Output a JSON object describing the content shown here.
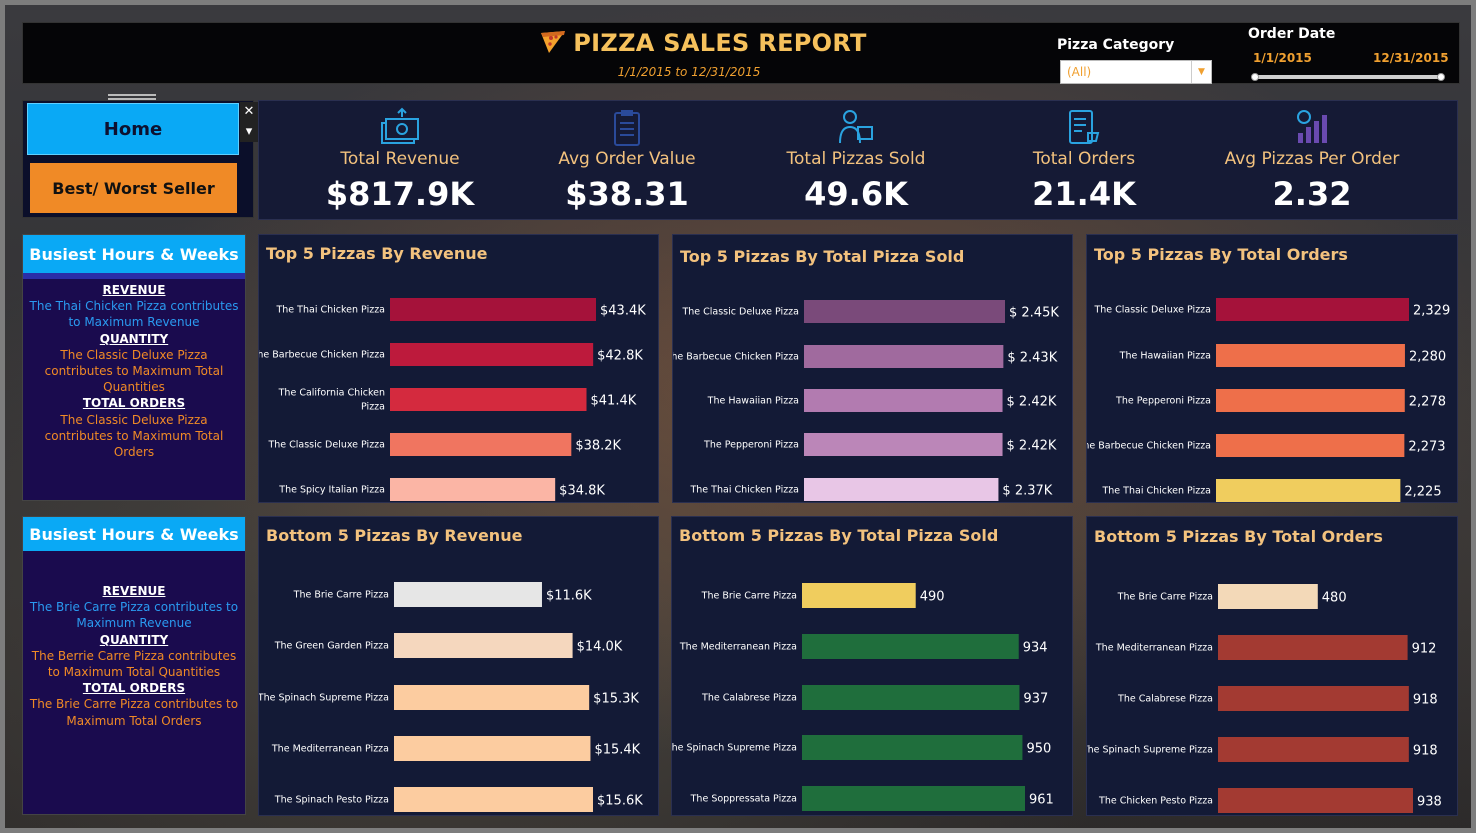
{
  "header": {
    "title": "PIZZA SALES REPORT",
    "date_range": "1/1/2015 to 12/31/2015",
    "pizza_category_label": "Pizza Category",
    "pizza_category_value": "(All)",
    "order_date_label": "Order Date",
    "order_date_start": "1/1/2015",
    "order_date_end": "12/31/2015"
  },
  "nav": {
    "home_label": "Home",
    "best_worst_label": "Best/ Worst Seller",
    "close_glyph": "✕",
    "menu_glyph": "▾"
  },
  "kpis": [
    {
      "label": "Total Revenue",
      "value": "$817.9K",
      "icon": "money-icon"
    },
    {
      "label": "Avg Order Value",
      "value": "$38.31",
      "icon": "clipboard-icon"
    },
    {
      "label": "Total Pizzas Sold",
      "value": "49.6K",
      "icon": "delivery-icon"
    },
    {
      "label": "Total Orders",
      "value": "21.4K",
      "icon": "order-list-icon"
    },
    {
      "label": "Avg Pizzas Per Order",
      "value": "2.32",
      "icon": "growth-chart-icon"
    }
  ],
  "top_panel": {
    "heading": "Busiest Hours & Weeks",
    "revenue_h": "REVENUE",
    "revenue_text": "The Thai Chicken Pizza contributes to Maximum Revenue",
    "quantity_h": "QUANTITY",
    "quantity_text": "The Classic Deluxe Pizza contributes to Maximum Total Quantities",
    "orders_h": "TOTAL ORDERS",
    "orders_text": "The Classic Deluxe Pizza contributes to Maximum Total Orders"
  },
  "bottom_panel": {
    "heading": "Busiest Hours & Weeks",
    "revenue_h": "REVENUE",
    "revenue_text": "The Brie Carre Pizza contributes to Maximum Revenue",
    "quantity_h": "QUANTITY",
    "quantity_text": "The Berrie Carre Pizza contributes to Maximum Total Quantities",
    "orders_h": "TOTAL ORDERS",
    "orders_text": "The Brie Carre Pizza contributes to Maximum Total Orders"
  },
  "colors": {
    "accent_blue": "#0aa9f5",
    "accent_orange": "#f08a26",
    "title_gold": "#f6c15c"
  },
  "chart_data": [
    {
      "type": "bar",
      "orientation": "horizontal",
      "title": "Top 5 Pizzas By Revenue",
      "categories": [
        "The Thai Chicken Pizza",
        "The Barbecue Chicken Pizza",
        "The California Chicken Pizza",
        "The Classic Deluxe Pizza",
        "The Spicy Italian Pizza"
      ],
      "values": [
        43.4,
        42.8,
        41.4,
        38.2,
        34.8
      ],
      "labels": [
        "$43.4K",
        "$42.8K",
        "$41.4K",
        "$38.2K",
        "$34.8K"
      ],
      "colors": [
        "#a5123a",
        "#bd1a3c",
        "#d42a3e",
        "#f07560",
        "#fbb5a5"
      ]
    },
    {
      "type": "bar",
      "orientation": "horizontal",
      "title": "Top 5 Pizzas By Total Pizza Sold",
      "categories": [
        "The Classic Deluxe Pizza",
        "The Barbecue Chicken Pizza",
        "The Hawaiian Pizza",
        "The Pepperoni Pizza",
        "The Thai Chicken Pizza"
      ],
      "values": [
        2.45,
        2.43,
        2.42,
        2.42,
        2.37
      ],
      "labels": [
        "$ 2.45K",
        "$ 2.43K",
        "$ 2.42K",
        "$ 2.42K",
        "$ 2.37K"
      ],
      "colors": [
        "#7a4a7a",
        "#a06a9e",
        "#b27bb0",
        "#bb86b8",
        "#e8c6e6"
      ]
    },
    {
      "type": "bar",
      "orientation": "horizontal",
      "title": "Top 5 Pizzas By Total Orders",
      "categories": [
        "The Classic Deluxe Pizza",
        "The Hawaiian Pizza",
        "The Pepperoni Pizza",
        "The Barbecue Chicken Pizza",
        "The Thai Chicken Pizza"
      ],
      "values": [
        2329,
        2280,
        2278,
        2273,
        2225
      ],
      "labels": [
        "2,329",
        "2,280",
        "2,278",
        "2,273",
        "2,225"
      ],
      "colors": [
        "#a5123a",
        "#ee6f4a",
        "#ee6f4a",
        "#ee6f4a",
        "#f0cd5e"
      ]
    },
    {
      "type": "bar",
      "orientation": "horizontal",
      "title": "Bottom 5 Pizzas By Revenue",
      "categories": [
        "The Brie Carre Pizza",
        "The Green Garden Pizza",
        "The Spinach Supreme Pizza",
        "The Mediterranean Pizza",
        "The Spinach Pesto Pizza"
      ],
      "values": [
        11.6,
        14.0,
        15.3,
        15.4,
        15.6
      ],
      "labels": [
        "$11.6K",
        "$14.0K",
        "$15.3K",
        "$15.4K",
        "$15.6K"
      ],
      "colors": [
        "#e6e6e6",
        "#f5d7be",
        "#fccca0",
        "#fccca0",
        "#fccca0"
      ]
    },
    {
      "type": "bar",
      "orientation": "horizontal",
      "title": "Bottom 5 Pizzas By Total Pizza Sold",
      "categories": [
        "The Brie Carre Pizza",
        "The Mediterranean Pizza",
        "The Calabrese Pizza",
        "The Spinach Supreme Pizza",
        "The Soppressata Pizza"
      ],
      "values": [
        490,
        934,
        937,
        950,
        961
      ],
      "labels": [
        "490",
        "934",
        "937",
        "950",
        "961"
      ],
      "colors": [
        "#f0cd5e",
        "#1f6e3c",
        "#1f6e3c",
        "#1f6e3c",
        "#1f6e3c"
      ]
    },
    {
      "type": "bar",
      "orientation": "horizontal",
      "title": "Bottom 5 Pizzas By Total Orders",
      "categories": [
        "The Brie Carre Pizza",
        "The Mediterranean Pizza",
        "The Calabrese Pizza",
        "The Spinach Supreme Pizza",
        "The Chicken Pesto Pizza"
      ],
      "values": [
        480,
        912,
        918,
        918,
        938
      ],
      "labels": [
        "480",
        "912",
        "918",
        "918",
        "938"
      ],
      "colors": [
        "#f3d9b8",
        "#a33a32",
        "#a33a32",
        "#a33a32",
        "#a33a32"
      ]
    }
  ]
}
